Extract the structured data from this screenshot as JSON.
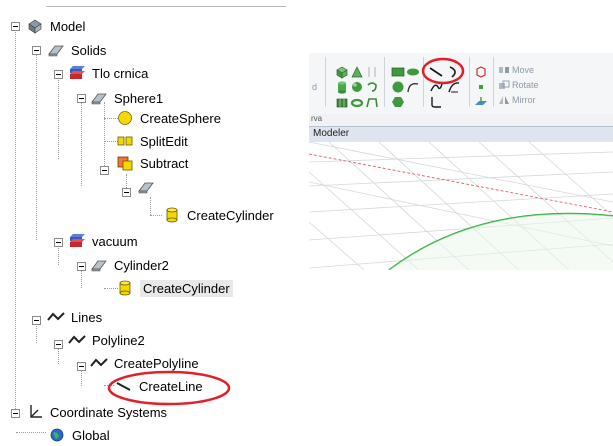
{
  "tree": {
    "model": "Model",
    "solids": "Solids",
    "tlo_crnica": "Tlo crnica",
    "sphere1": "Sphere1",
    "create_sphere": "CreateSphere",
    "split_edit": "SplitEdit",
    "subtract": "Subtract",
    "create_cylinder_1": "CreateCylinder",
    "vacuum": "vacuum",
    "cylinder2": "Cylinder2",
    "create_cylinder_2": "CreateCylinder",
    "lines": "Lines",
    "polyline2": "Polyline2",
    "create_polyline": "CreatePolyline",
    "create_line": "CreateLine",
    "coordinate_systems": "Coordinate Systems",
    "global": "Global"
  },
  "ribbon": {
    "left_fragment": "d",
    "move": "Move",
    "rotate": "Rotate",
    "mirror": "Mirror",
    "tab_fragment": "rva"
  },
  "modeler": {
    "title": "Modeler"
  },
  "colors": {
    "annotation_red": "#e0202a",
    "selection_bg": "#e8e8e8",
    "grid_green": "#2faa3a",
    "grid_red": "#e05050"
  }
}
